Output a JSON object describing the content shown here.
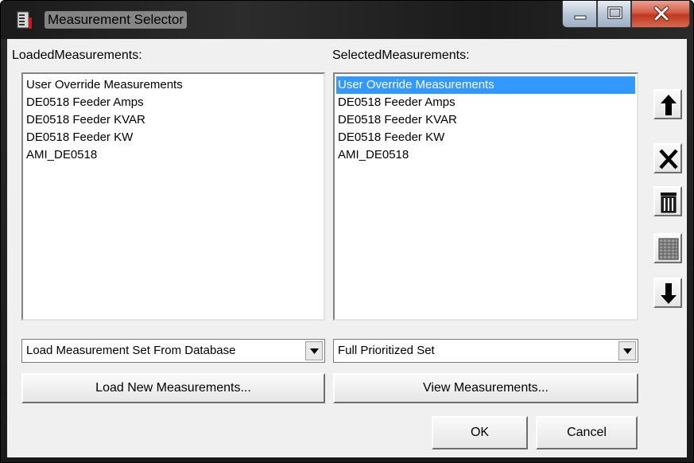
{
  "window": {
    "title": "Measurement Selector",
    "app_icon": "measurement-app-icon"
  },
  "left_panel": {
    "label": "LoadedMeasurements:",
    "items": [
      "User Override Measurements",
      "DE0518 Feeder Amps",
      "DE0518 Feeder KVAR",
      "DE0518 Feeder KW",
      "AMI_DE0518"
    ],
    "dropdown_value": "Load Measurement Set From Database",
    "button_label": "Load New Measurements..."
  },
  "right_panel": {
    "label": "SelectedMeasurements:",
    "items": [
      "User Override Measurements",
      "DE0518 Feeder Amps",
      "DE0518 Feeder KVAR",
      "DE0518 Feeder KW",
      "AMI_DE0518"
    ],
    "selected_index": 0,
    "dropdown_value": "Full Prioritized Set",
    "button_label": "View Measurements..."
  },
  "side_toolbar": {
    "buttons": [
      {
        "name": "move-up",
        "icon": "arrow-up-icon"
      },
      {
        "name": "remove",
        "icon": "x-icon"
      },
      {
        "name": "delete",
        "icon": "trash-icon"
      },
      {
        "name": "grid",
        "icon": "grid-icon"
      },
      {
        "name": "move-down",
        "icon": "arrow-down-icon"
      }
    ]
  },
  "footer": {
    "ok_label": "OK",
    "cancel_label": "Cancel"
  },
  "colors": {
    "selection": "#3399ff",
    "close_button": "#c0371f",
    "dialog_bg": "#f0f0f0"
  }
}
